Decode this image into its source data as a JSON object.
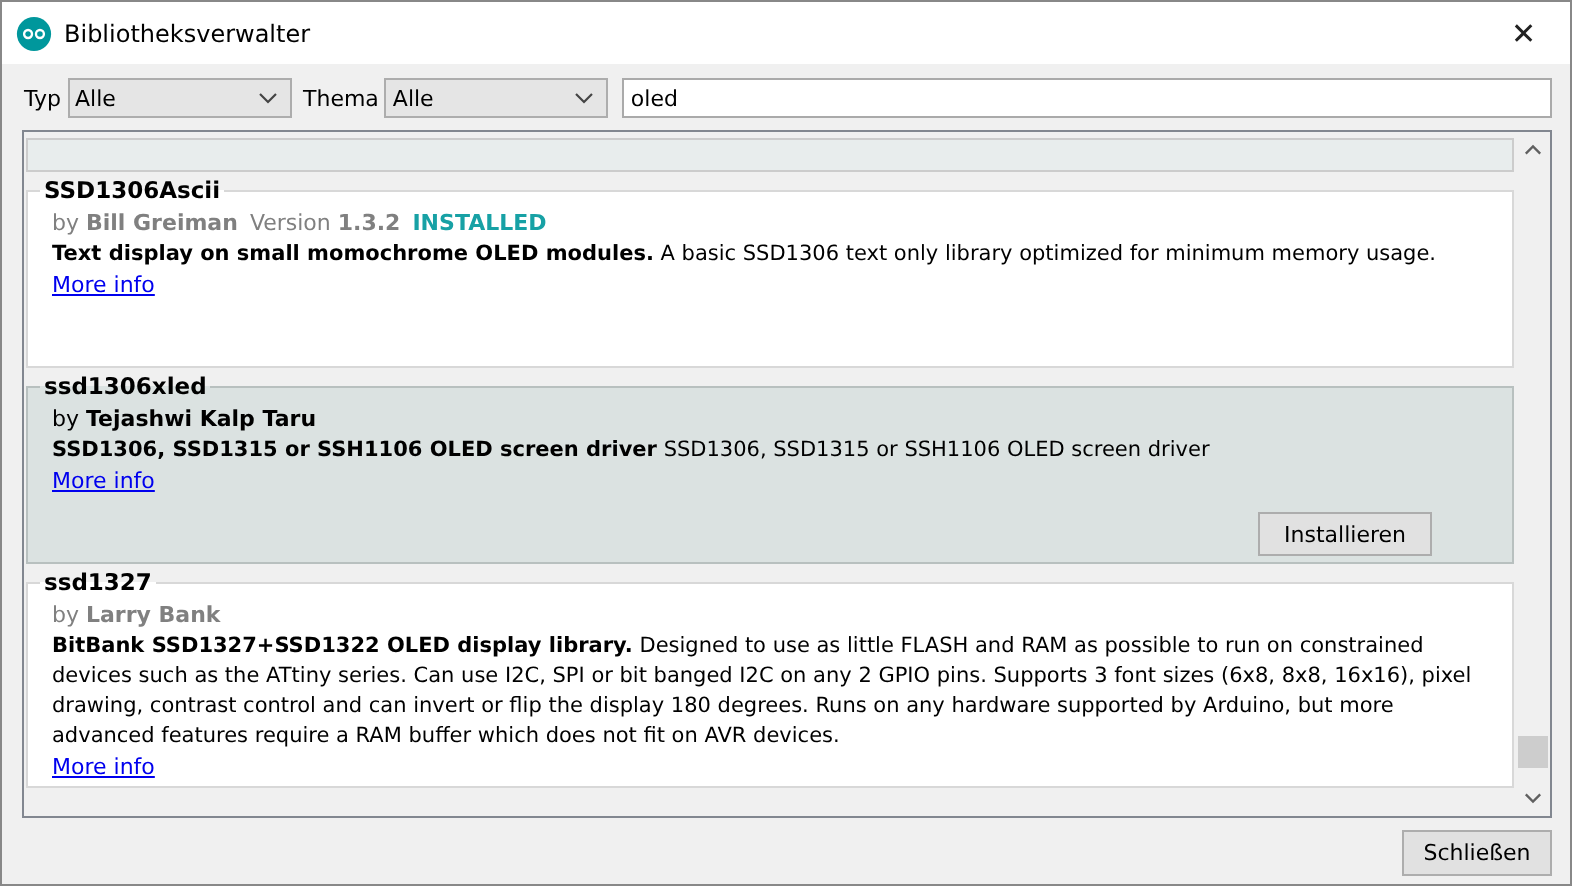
{
  "window": {
    "title": "Bibliotheksverwalter",
    "close": "✕"
  },
  "filters": [
    {
      "label": "Typ",
      "value": "Alle"
    },
    {
      "label": "Thema",
      "value": "Alle"
    }
  ],
  "search": {
    "value": "oled"
  },
  "libraries": [
    {
      "name": "SSD1306Ascii",
      "author": "by **Bill Greiman**",
      "version": "Version **1.3.2**",
      "status": "INSTALLED",
      "description": "**Text display on small momochrome OLED modules.** A basic SSD1306 text only library optimized for minimum memory usage.",
      "more_info": "More info",
      "selected": false
    },
    {
      "name": "ssd1306xled",
      "author": "by **Tejashwi Kalp Taru**",
      "description": "**SSD1306, SSD1315 or SSH1106 OLED screen driver** SSD1306, SSD1315 or SSH1106 OLED screen driver",
      "more_info": "More info",
      "selected": true,
      "button": "Installieren"
    },
    {
      "name": "ssd1327",
      "author": "by **Larry Bank**",
      "description": "**BitBank SSD1327+SSD1322 OLED display library.** Designed to use as little FLASH and RAM as possible to run on constrained devices such as the ATtiny series. Can use I2C, SPI or bit banged I2C on any 2 GPIO pins. Supports 3 font sizes (6x8, 8x8, 16x16), pixel drawing, contrast control and can invert or flip the display 180 degrees. Runs on any hardware supported by Arduino, but more advanced features require a RAM buffer which does not fit on AVR devices.",
      "more_info": "More info",
      "selected": false
    }
  ],
  "close_button": "Schließen"
}
